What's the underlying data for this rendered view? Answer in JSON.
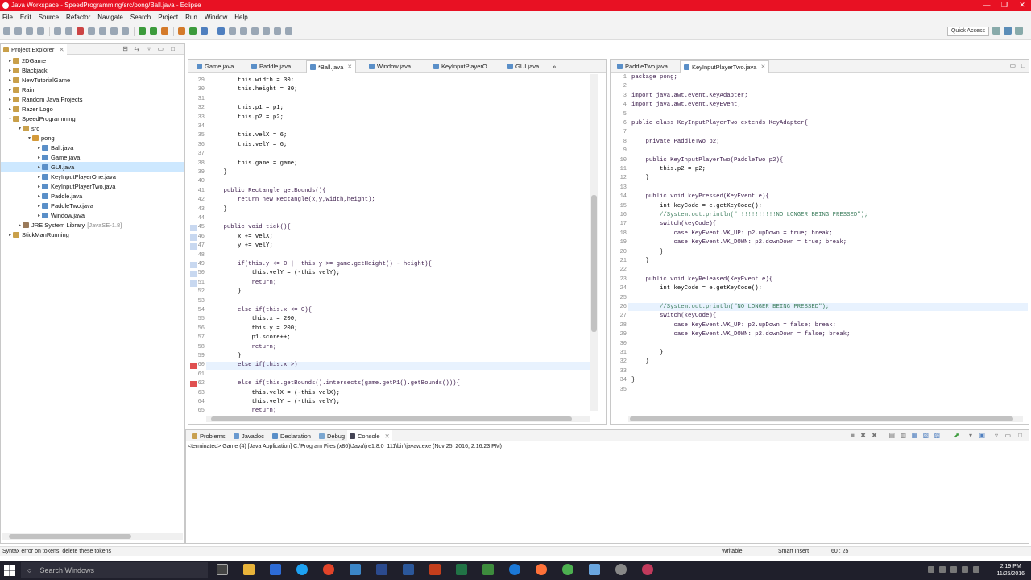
{
  "window": {
    "title": "Java Workspace - SpeedProgramming/src/pong/Ball.java - Eclipse",
    "controls": [
      "—",
      "❐",
      "✕"
    ]
  },
  "menu": [
    "File",
    "Edit",
    "Source",
    "Refactor",
    "Navigate",
    "Search",
    "Project",
    "Run",
    "Window",
    "Help"
  ],
  "toolbar": {
    "quick_access": "Quick Access"
  },
  "explorer": {
    "title": "Project Explorer",
    "items": [
      {
        "label": "2DGame",
        "depth": 0,
        "type": "proj",
        "tw": "▸"
      },
      {
        "label": "Blackjack",
        "depth": 0,
        "type": "proj",
        "tw": "▸"
      },
      {
        "label": "NewTutorialGame",
        "depth": 0,
        "type": "proj",
        "tw": "▸"
      },
      {
        "label": "Rain",
        "depth": 0,
        "type": "proj",
        "tw": "▸"
      },
      {
        "label": "Random Java Projects",
        "depth": 0,
        "type": "proj",
        "tw": "▸"
      },
      {
        "label": "Razer Logo",
        "depth": 0,
        "type": "proj",
        "tw": "▸"
      },
      {
        "label": "SpeedProgramming",
        "depth": 0,
        "type": "proj",
        "tw": "▾"
      },
      {
        "label": "src",
        "depth": 1,
        "type": "src",
        "tw": "▾"
      },
      {
        "label": "pong",
        "depth": 2,
        "type": "pkg",
        "tw": "▾"
      },
      {
        "label": "Ball.java",
        "depth": 3,
        "type": "j",
        "tw": "▸"
      },
      {
        "label": "Game.java",
        "depth": 3,
        "type": "j",
        "tw": "▸"
      },
      {
        "label": "GUI.java",
        "depth": 3,
        "type": "j",
        "tw": "▸",
        "selected": true
      },
      {
        "label": "KeyInputPlayerOne.java",
        "depth": 3,
        "type": "j",
        "tw": "▸"
      },
      {
        "label": "KeyInputPlayerTwo.java",
        "depth": 3,
        "type": "j",
        "tw": "▸"
      },
      {
        "label": "Paddle.java",
        "depth": 3,
        "type": "j",
        "tw": "▸"
      },
      {
        "label": "PaddleTwo.java",
        "depth": 3,
        "type": "j",
        "tw": "▸"
      },
      {
        "label": "Window.java",
        "depth": 3,
        "type": "j",
        "tw": "▸"
      },
      {
        "label": "JRE System Library",
        "suffix": "[JavaSE-1.8]",
        "depth": 1,
        "type": "lib",
        "tw": "▸"
      },
      {
        "label": "StickManRunning",
        "depth": 0,
        "type": "proj",
        "tw": "▸"
      }
    ]
  },
  "left_editor": {
    "tabs": [
      "Game.java",
      "Paddle.java",
      "*Ball.java",
      "Window.java",
      "KeyInputPlayerO",
      "GUI.java"
    ],
    "overflow": "»",
    "lines": [
      {
        "n": "29",
        "t": "        this.width = 30;"
      },
      {
        "n": "30",
        "t": "        this.height = 30;"
      },
      {
        "n": "31",
        "t": ""
      },
      {
        "n": "32",
        "t": "        this.p1 = p1;"
      },
      {
        "n": "33",
        "t": "        this.p2 = p2;"
      },
      {
        "n": "34",
        "t": ""
      },
      {
        "n": "35",
        "t": "        this.velX = 6;"
      },
      {
        "n": "36",
        "t": "        this.velY = 6;"
      },
      {
        "n": "37",
        "t": ""
      },
      {
        "n": "38",
        "t": "        this.game = game;"
      },
      {
        "n": "39",
        "t": "    }"
      },
      {
        "n": "40",
        "t": ""
      },
      {
        "n": "41",
        "t": "    public Rectangle getBounds(){"
      },
      {
        "n": "42",
        "t": "        return new Rectangle(x,y,width,height);"
      },
      {
        "n": "43",
        "t": "    }"
      },
      {
        "n": "44",
        "t": ""
      },
      {
        "n": "45",
        "t": "    public void tick(){"
      },
      {
        "n": "46",
        "t": "        x += velX;"
      },
      {
        "n": "47",
        "t": "        y += velY;"
      },
      {
        "n": "48",
        "t": ""
      },
      {
        "n": "49",
        "t": "        if(this.y <= 0 || this.y >= game.getHeight() - height){"
      },
      {
        "n": "50",
        "t": "            this.velY = (-this.velY);"
      },
      {
        "n": "51",
        "t": "            return;"
      },
      {
        "n": "52",
        "t": "        }"
      },
      {
        "n": "53",
        "t": ""
      },
      {
        "n": "54",
        "t": "        else if(this.x <= 0){"
      },
      {
        "n": "55",
        "t": "            this.x = 200;"
      },
      {
        "n": "56",
        "t": "            this.y = 200;"
      },
      {
        "n": "57",
        "t": "            p1.score++;"
      },
      {
        "n": "58",
        "t": "            return;"
      },
      {
        "n": "59",
        "t": "        }"
      },
      {
        "n": "60",
        "t": "        else if(this.x >)"
      },
      {
        "n": "61",
        "t": ""
      },
      {
        "n": "62",
        "t": "        else if(this.getBounds().intersects(game.getP1().getBounds())){"
      },
      {
        "n": "63",
        "t": "            this.velX = (-this.velX);"
      },
      {
        "n": "64",
        "t": "            this.velY = (-this.velY);"
      },
      {
        "n": "65",
        "t": "            return;"
      }
    ]
  },
  "right_editor": {
    "tabs": [
      "PaddleTwo.java",
      "KeyInputPlayerTwo.java"
    ],
    "lines": [
      {
        "n": "1",
        "t": "package pong;"
      },
      {
        "n": "2",
        "t": ""
      },
      {
        "n": "3",
        "t": "import java.awt.event.KeyAdapter;"
      },
      {
        "n": "4",
        "t": "import java.awt.event.KeyEvent;"
      },
      {
        "n": "5",
        "t": ""
      },
      {
        "n": "6",
        "t": "public class KeyInputPlayerTwo extends KeyAdapter{"
      },
      {
        "n": "7",
        "t": ""
      },
      {
        "n": "8",
        "t": "    private PaddleTwo p2;"
      },
      {
        "n": "9",
        "t": ""
      },
      {
        "n": "10",
        "t": "    public KeyInputPlayerTwo(PaddleTwo p2){"
      },
      {
        "n": "11",
        "t": "        this.p2 = p2;"
      },
      {
        "n": "12",
        "t": "    }"
      },
      {
        "n": "13",
        "t": ""
      },
      {
        "n": "14",
        "t": "    public void keyPressed(KeyEvent e){"
      },
      {
        "n": "15",
        "t": "        int keyCode = e.getKeyCode();"
      },
      {
        "n": "16",
        "t": "        //System.out.println(\"!!!!!!!!!!!NO LONGER BEING PRESSED\");"
      },
      {
        "n": "17",
        "t": "        switch(keyCode){"
      },
      {
        "n": "18",
        "t": "            case KeyEvent.VK_UP: p2.upDown = true; break;"
      },
      {
        "n": "19",
        "t": "            case KeyEvent.VK_DOWN: p2.downDown = true; break;"
      },
      {
        "n": "20",
        "t": "        }"
      },
      {
        "n": "21",
        "t": "    }"
      },
      {
        "n": "22",
        "t": ""
      },
      {
        "n": "23",
        "t": "    public void keyReleased(KeyEvent e){"
      },
      {
        "n": "24",
        "t": "        int keyCode = e.getKeyCode();"
      },
      {
        "n": "25",
        "t": ""
      },
      {
        "n": "26",
        "t": "        //System.out.println(\"NO LONGER BEING PRESSED\");"
      },
      {
        "n": "27",
        "t": "        switch(keyCode){"
      },
      {
        "n": "28",
        "t": "            case KeyEvent.VK_UP: p2.upDown = false; break;"
      },
      {
        "n": "29",
        "t": "            case KeyEvent.VK_DOWN: p2.downDown = false; break;"
      },
      {
        "n": "30",
        "t": ""
      },
      {
        "n": "31",
        "t": "        }"
      },
      {
        "n": "32",
        "t": "    }"
      },
      {
        "n": "33",
        "t": ""
      },
      {
        "n": "34",
        "t": "}"
      },
      {
        "n": "35",
        "t": ""
      }
    ]
  },
  "bottom": {
    "tabs": [
      "Problems",
      "Javadoc",
      "Declaration",
      "Debug",
      "Console"
    ],
    "console_header": "<terminated> Game (4) [Java Application] C:\\Program Files (x86)\\Java\\jre1.8.0_111\\bin\\javaw.exe (Nov 25, 2016, 2:16:23 PM)"
  },
  "status": {
    "message": "Syntax error on tokens, delete these tokens",
    "writable": "Writable",
    "insert_mode": "Smart Insert",
    "position": "60 : 25"
  },
  "taskbar": {
    "search": "Search Windows",
    "time": "2:19 PM",
    "date": "11/25/2016"
  }
}
